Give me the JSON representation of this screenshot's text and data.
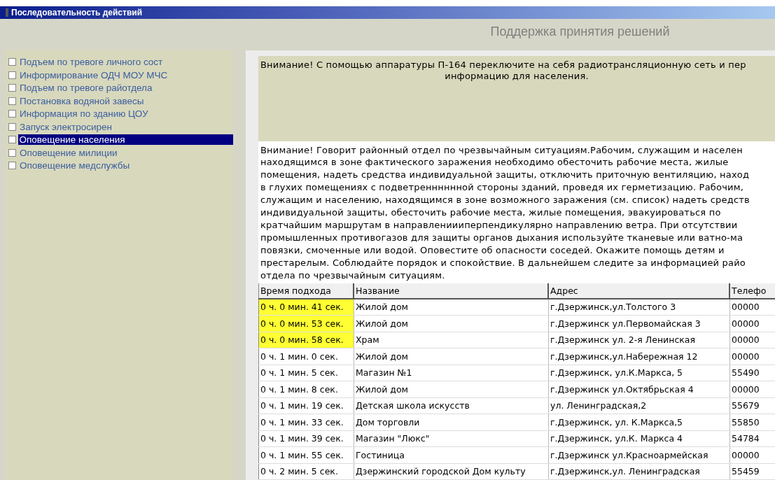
{
  "window": {
    "title": "Последовательность действий"
  },
  "header": {
    "title": "Поддержка принятия решений"
  },
  "steps": [
    {
      "label": "Подъем по тревоге личного сост",
      "checked": false,
      "selected": false
    },
    {
      "label": "Информирование ОДЧ МОУ МЧС",
      "checked": false,
      "selected": false
    },
    {
      "label": "Подъем по тревоге райотдела",
      "checked": false,
      "selected": false
    },
    {
      "label": "Постановка водяной завесы",
      "checked": false,
      "selected": false
    },
    {
      "label": "Информация по зданию ЦОУ",
      "checked": false,
      "selected": false
    },
    {
      "label": "Запуск электросирен",
      "checked": false,
      "selected": false
    },
    {
      "label": "Оповещение населения",
      "checked": false,
      "selected": true
    },
    {
      "label": "Оповещение милиции",
      "checked": false,
      "selected": false
    },
    {
      "label": "Оповещение медслужбы",
      "checked": false,
      "selected": false
    }
  ],
  "alert": {
    "lines": [
      "Внимание! С помощью аппаратуры П-164 переключите на себя радиотрансляционную сеть и пер",
      "информацию для населения."
    ]
  },
  "message": {
    "lines": [
      "Внимание! Говорит районный отдел по чрезвычайным ситуациям.Рабочим, служащим и населен",
      "находящимся в зоне фактического заражения необходимо обесточить рабочие места, жилые",
      "помещения, надеть средства индивидуальной защиты, отключить приточную вентиляцию, наход",
      "в глухих помещениях с подветренннннной стороны зданий, проведя их герметизацию. Рабочим,",
      "служащим и населению, находящимся в зоне возможного заражения (см. список) надеть средств",
      "индивидуальной защиты, обесточить рабочие места, жилые помещения, эвакуироваться по",
      "кратчайшим маршрутам в направлениииперпендикулярно направлению ветра. При отсутствии",
      "промышленных противогазов для защиты органов дыхания используйте тканевые или ватно-ма",
      "повязки, смоченные или водой. Оповестите об опасности соседей. Окажите помощь детям и",
      "престарелым. Соблюдайте порядок и спокойствие. В дальнейшем следите за информацией райо",
      "отдела по чрезвычайным ситуациям."
    ]
  },
  "table": {
    "columns": [
      "Время подхода",
      "Название",
      "Адрес",
      "Телефо"
    ],
    "rows": [
      {
        "cells": [
          "0 ч. 0 мин. 41 сек.",
          "Жилой дом",
          "г.Дзержинск,ул.Толстого 3",
          "00000"
        ],
        "highlighted": true
      },
      {
        "cells": [
          "0 ч. 0 мин. 53 сек.",
          "Жилой дом",
          "г.Дзержинск ул.Первомайская 3",
          "00000"
        ],
        "highlighted": true
      },
      {
        "cells": [
          "0 ч. 0 мин. 58 сек.",
          "Храм",
          "г.Дзержинск ул. 2-я Ленинская",
          "00000"
        ],
        "highlighted": true
      },
      {
        "cells": [
          "0 ч. 1 мин. 0 сек.",
          "Жилой дом",
          "г.Дзержинск,ул.Набережная 12",
          "00000"
        ],
        "highlighted": false
      },
      {
        "cells": [
          "0 ч. 1 мин. 5 сек.",
          "Магазин №1",
          "г.Дзержинск, ул.К.Маркса, 5",
          "55490"
        ],
        "highlighted": false
      },
      {
        "cells": [
          "0 ч. 1 мин. 8 сек.",
          "Жилой дом",
          "г.Дзержинск ул.Октябрьская 4",
          "00000"
        ],
        "highlighted": false
      },
      {
        "cells": [
          "0 ч. 1 мин. 19 сек.",
          "Детская школа искусств",
          "ул. Ленинградская,2",
          "55679"
        ],
        "highlighted": false
      },
      {
        "cells": [
          "0 ч. 1 мин. 33 сек.",
          "Дом торговли",
          "г.Дзержинск, ул. К.Маркса,5",
          "55850"
        ],
        "highlighted": false
      },
      {
        "cells": [
          "0 ч. 1 мин. 39 сек.",
          "Магазин \"Люкс\"",
          "г.Дзержинск, ул.К. Маркса 4",
          "54784"
        ],
        "highlighted": false
      },
      {
        "cells": [
          "0 ч. 1 мин. 55 сек.",
          "Гостиница",
          "г.Дзержинск ул.Красноармейская",
          "00000"
        ],
        "highlighted": false
      },
      {
        "cells": [
          "0 ч. 2 мин. 5 сек.",
          "Дзержинский городской Дом культу",
          "г.Дзержинск,ул. Ленинградская",
          "55459"
        ],
        "highlighted": false
      }
    ]
  }
}
